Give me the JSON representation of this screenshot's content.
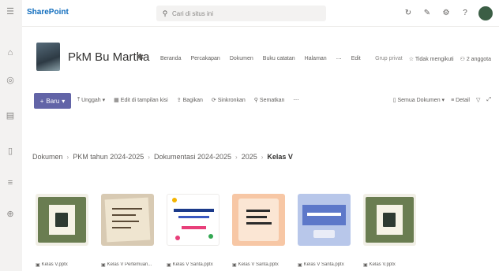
{
  "suite": {
    "app_name": "SharePoint",
    "search_placeholder": "Cari di situs ini"
  },
  "site": {
    "title": "PkM Bu Martha",
    "nav": [
      "Beranda",
      "Percakapan",
      "Dokumen",
      "Buku catatan",
      "Halaman",
      "Edit"
    ],
    "privacy": "Grup privat",
    "follow": "Tidak mengikuti",
    "members": "2 anggota"
  },
  "commands": {
    "new_label": "Baru",
    "items": [
      "Unggah",
      "Edit di tampilan kisi",
      "Bagikan",
      "Sinkronkan",
      "Sematkan"
    ],
    "view": "Semua Dokumen",
    "detail": "Detail"
  },
  "breadcrumb": [
    "Dokumen",
    "PKM tahun 2024-2025",
    "Dokumentasi 2024-2025",
    "2025",
    "Kelas V"
  ],
  "files": [
    {
      "name": "Kelas V.pptx"
    },
    {
      "name": "Kelas V Pertemuan..."
    },
    {
      "name": "Kelas V Santa.pptx"
    },
    {
      "name": "Kelas V Santa.pptx"
    },
    {
      "name": "Kelas V Santa.pptx"
    },
    {
      "name": "Kelas V.pptx"
    }
  ]
}
